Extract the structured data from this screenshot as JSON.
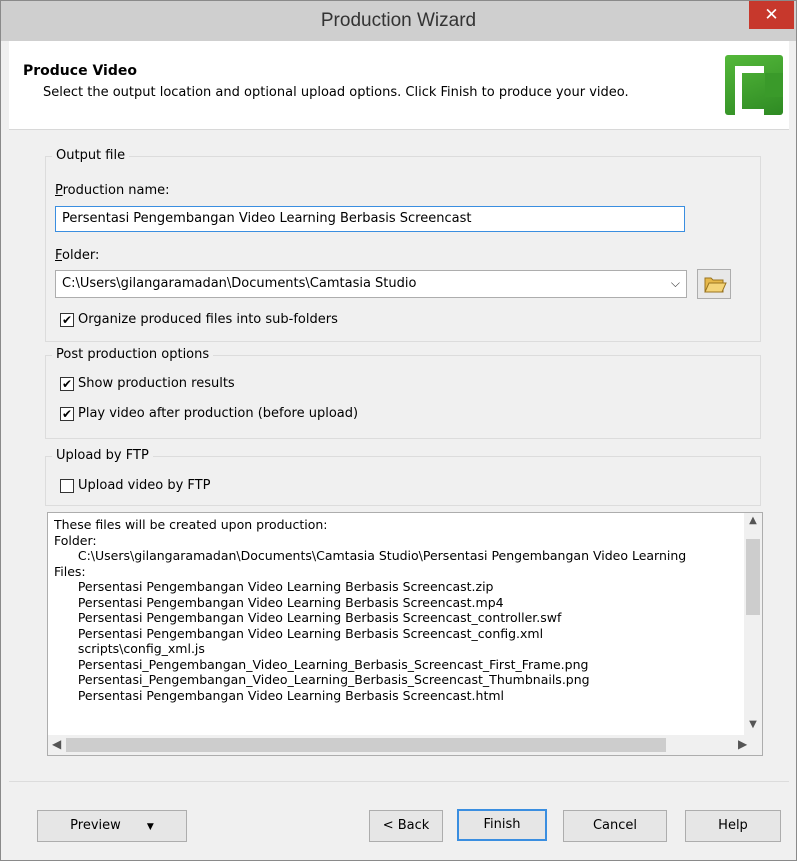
{
  "window": {
    "title": "Production Wizard",
    "close_glyph": "✕"
  },
  "header": {
    "title": "Produce Video",
    "description": "Select the output location and optional upload options. Click Finish to produce your video."
  },
  "output_file": {
    "legend": "Output file",
    "production_name_label": "Production name:",
    "production_name_value": "Persentasi Pengembangan Video Learning Berbasis Screencast",
    "folder_label": "Folder:",
    "folder_value": "C:\\Users\\gilangaramadan\\Documents\\Camtasia Studio",
    "organize_label": "Organize produced files into sub-folders",
    "organize_checked": true
  },
  "post_production": {
    "legend": "Post production options",
    "show_results_label": "Show production results",
    "show_results_checked": true,
    "play_video_label": "Play video after production (before upload)",
    "play_video_checked": true
  },
  "upload_ftp": {
    "legend": "Upload by FTP",
    "upload_label": "Upload video by FTP",
    "upload_checked": false
  },
  "file_list": {
    "lines": [
      "These files will be created upon production:",
      "Folder:",
      "      C:\\Users\\gilangaramadan\\Documents\\Camtasia Studio\\Persentasi Pengembangan Video Learning",
      "Files:",
      "      Persentasi Pengembangan Video Learning Berbasis Screencast.zip",
      "      Persentasi Pengembangan Video Learning Berbasis Screencast.mp4",
      "      Persentasi Pengembangan Video Learning Berbasis Screencast_controller.swf",
      "      Persentasi Pengembangan Video Learning Berbasis Screencast_config.xml",
      "      scripts\\config_xml.js",
      "      Persentasi_Pengembangan_Video_Learning_Berbasis_Screencast_First_Frame.png",
      "      Persentasi_Pengembangan_Video_Learning_Berbasis_Screencast_Thumbnails.png",
      "      Persentasi Pengembangan Video Learning Berbasis Screencast.html"
    ]
  },
  "buttons": {
    "preview": "Preview",
    "back": "< Back",
    "finish": "Finish",
    "cancel": "Cancel",
    "help": "Help"
  },
  "icons": {
    "folder_browse": "folder-open-icon",
    "combo_arrow": "chevron-down-icon",
    "close": "close-icon",
    "logo": "camtasia-logo-icon"
  },
  "colors": {
    "title_bar": "#cfcfcf",
    "close_button": "#c7382c",
    "focus_border": "#3a8ee0",
    "logo_green": "#3a9a2a"
  }
}
